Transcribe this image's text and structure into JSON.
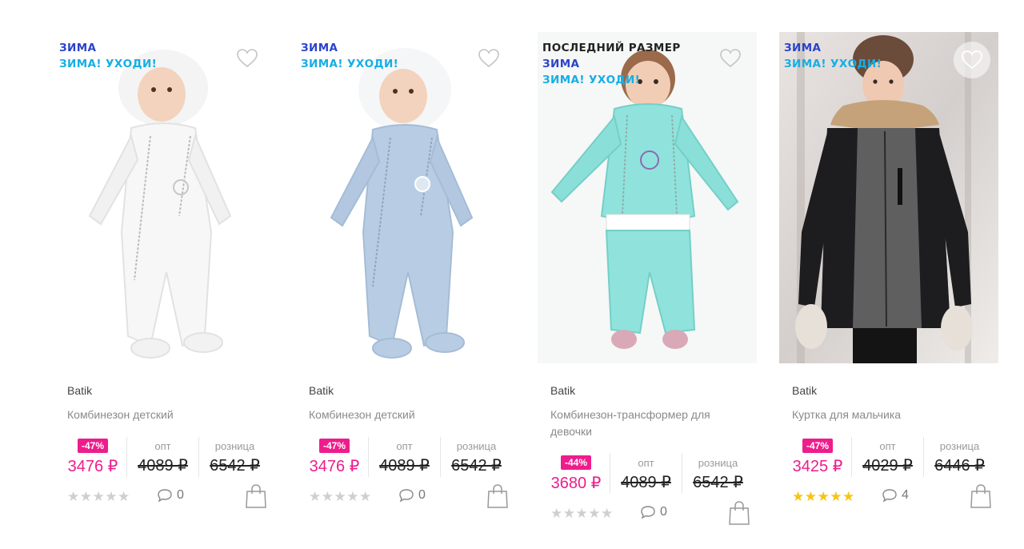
{
  "products": [
    {
      "badges": [
        {
          "text": "ЗИМА",
          "color": "blue"
        },
        {
          "text": "ЗИМА! УХОДИ!",
          "color": "cyan"
        }
      ],
      "image_icon": "white-baby-overall-photo",
      "brand": "Batik",
      "name": "Комбинезон детский",
      "discount": "-47%",
      "opt_label": "опт",
      "retail_label": "розница",
      "price": "3476 ₽",
      "opt_price": "4089 ₽",
      "retail_price": "6542 ₽",
      "rating": 0,
      "stars": "★★★★★",
      "comments": "0"
    },
    {
      "badges": [
        {
          "text": "ЗИМА",
          "color": "blue"
        },
        {
          "text": "ЗИМА! УХОДИ!",
          "color": "cyan"
        }
      ],
      "image_icon": "blue-baby-overall-photo",
      "brand": "Batik",
      "name": "Комбинезон детский",
      "discount": "-47%",
      "opt_label": "опт",
      "retail_label": "розница",
      "price": "3476 ₽",
      "opt_price": "4089 ₽",
      "retail_price": "6542 ₽",
      "rating": 0,
      "stars": "★★★★★",
      "comments": "0"
    },
    {
      "badges": [
        {
          "text": "ПОСЛЕДНИЙ РАЗМЕР",
          "color": "dark"
        },
        {
          "text": "ЗИМА",
          "color": "blue"
        },
        {
          "text": "ЗИМА! УХОДИ!",
          "color": "cyan"
        }
      ],
      "image_icon": "mint-transformer-overall-photo",
      "brand": "Batik",
      "name": "Комбинезон-трансформер для девочки",
      "discount": "-44%",
      "opt_label": "опт",
      "retail_label": "розница",
      "price": "3680 ₽",
      "opt_price": "4089 ₽",
      "retail_price": "6542 ₽",
      "rating": 0,
      "stars": "★★★★★",
      "comments": "0"
    },
    {
      "badges": [
        {
          "text": "ЗИМА",
          "color": "blue"
        },
        {
          "text": "ЗИМА! УХОДИ!",
          "color": "cyan"
        }
      ],
      "image_icon": "boy-winter-jacket-photo",
      "brand": "Batik",
      "name": "Куртка для мальчика",
      "discount": "-47%",
      "opt_label": "опт",
      "retail_label": "розница",
      "price": "3425 ₽",
      "opt_price": "4029 ₽",
      "retail_price": "6446 ₽",
      "rating": 5,
      "stars": "★★★★★",
      "comments": "4"
    }
  ],
  "colors": {
    "accent_pink": "#ee1d8c",
    "badge_blue": "#2b44c9",
    "badge_cyan": "#16aee5",
    "star_gold": "#f5c518",
    "star_empty": "#cfcfcf"
  }
}
